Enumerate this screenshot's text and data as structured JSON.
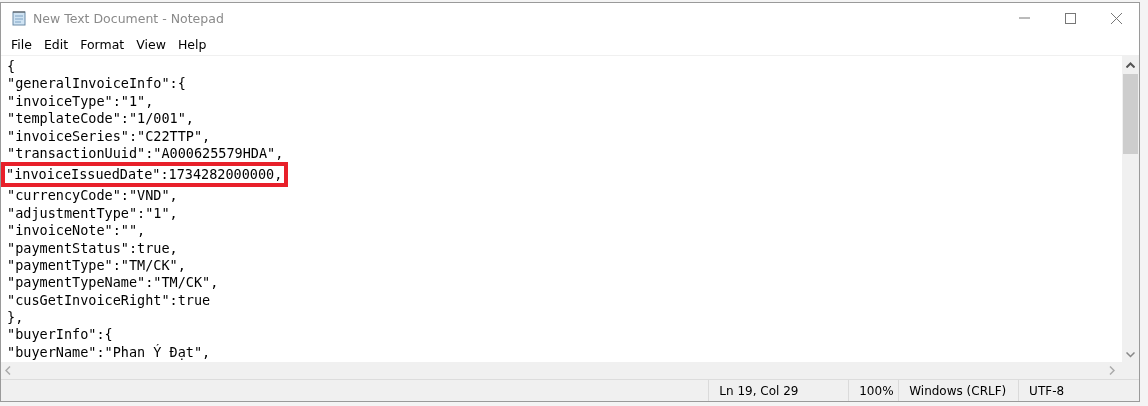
{
  "window": {
    "title": "New Text Document - Notepad"
  },
  "menu": [
    {
      "label": "File"
    },
    {
      "label": "Edit"
    },
    {
      "label": "Format"
    },
    {
      "label": "View"
    },
    {
      "label": "Help"
    }
  ],
  "editor": {
    "lines": [
      {
        "text": "{",
        "highlighted": false
      },
      {
        "text": "\"generalInvoiceInfo\":{",
        "highlighted": false
      },
      {
        "text": "\"invoiceType\":\"1\",",
        "highlighted": false
      },
      {
        "text": "\"templateCode\":\"1/001\",",
        "highlighted": false
      },
      {
        "text": "\"invoiceSeries\":\"C22TTP\",",
        "highlighted": false
      },
      {
        "text": "\"transactionUuid\":\"A000625579HDA\",",
        "highlighted": false
      },
      {
        "text": "\"invoiceIssuedDate\":1734282000000,",
        "highlighted": true
      },
      {
        "text": "\"currencyCode\":\"VND\",",
        "highlighted": false
      },
      {
        "text": "\"adjustmentType\":\"1\",",
        "highlighted": false
      },
      {
        "text": "\"invoiceNote\":\"\",",
        "highlighted": false
      },
      {
        "text": "\"paymentStatus\":true,",
        "highlighted": false
      },
      {
        "text": "\"paymentType\":\"TM/CK\",",
        "highlighted": false
      },
      {
        "text": "\"paymentTypeName\":\"TM/CK\",",
        "highlighted": false
      },
      {
        "text": "\"cusGetInvoiceRight\":true",
        "highlighted": false
      },
      {
        "text": "},",
        "highlighted": false
      },
      {
        "text": "\"buyerInfo\":{",
        "highlighted": false
      },
      {
        "text": "\"buyerName\":\"Phan Ý Đạt\",",
        "highlighted": false
      }
    ]
  },
  "status_bar": [
    "Ln 19, Col 29",
    "100%",
    "Windows (CRLF)",
    "UTF-8"
  ]
}
